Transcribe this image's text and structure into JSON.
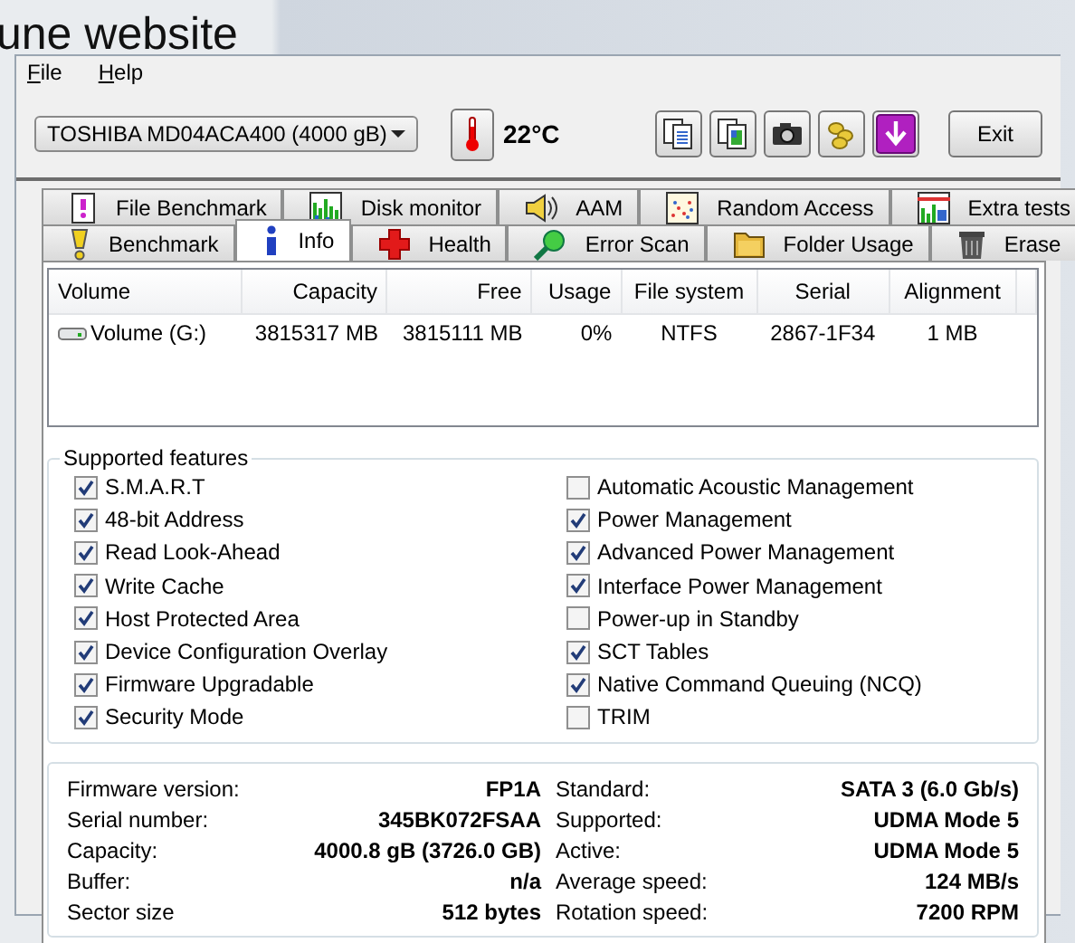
{
  "background": {
    "title": "une website"
  },
  "menu": [
    {
      "label": "File"
    },
    {
      "label": "Help"
    }
  ],
  "toolbar": {
    "drive": "TOSHIBA MD04ACA400 (4000 gB)",
    "temperature": "22°C",
    "buttons": [
      {
        "kind": "copy"
      },
      {
        "kind": "copy_color"
      },
      {
        "kind": "camera"
      },
      {
        "kind": "coins"
      },
      {
        "kind": "download"
      }
    ],
    "exit": "Exit"
  },
  "tabs": [
    [
      {
        "label": "File Benchmark",
        "kind": "page",
        "selected": false
      },
      {
        "label": "Disk monitor",
        "kind": "bars",
        "selected": false
      },
      {
        "label": "AAM",
        "kind": "speaker",
        "selected": false
      },
      {
        "label": "Random Access",
        "kind": "scatter",
        "selected": false
      },
      {
        "label": "Extra tests",
        "kind": "chart",
        "selected": false
      }
    ],
    [
      {
        "label": "Benchmark",
        "kind": "exclaim",
        "selected": false
      },
      {
        "label": "Info",
        "kind": "info",
        "selected": true
      },
      {
        "label": "Health",
        "kind": "cross",
        "selected": false
      },
      {
        "label": "Error Scan",
        "kind": "magnifier",
        "selected": false
      },
      {
        "label": "Folder Usage",
        "kind": "folder",
        "selected": false
      },
      {
        "label": "Erase",
        "kind": "trash",
        "selected": false
      }
    ]
  ],
  "volumes": {
    "columns": [
      "Volume",
      "Capacity",
      "Free",
      "Usage",
      "File system",
      "Serial",
      "Alignment"
    ],
    "rows": [
      [
        "Volume (G:)",
        "3815317 MB",
        "3815111 MB",
        "0%",
        "NTFS",
        "2867-1F34",
        "1 MB"
      ]
    ]
  },
  "features": {
    "title": "Supported features",
    "left": [
      {
        "label": "S.M.A.R.T",
        "checked": true
      },
      {
        "label": "48-bit Address",
        "checked": true
      },
      {
        "label": "Read Look-Ahead",
        "checked": true
      },
      {
        "label": "Write Cache",
        "checked": true
      },
      {
        "label": "Host Protected Area",
        "checked": true
      },
      {
        "label": "Device Configuration Overlay",
        "checked": true
      },
      {
        "label": "Firmware Upgradable",
        "checked": true
      },
      {
        "label": "Security Mode",
        "checked": true
      }
    ],
    "right": [
      {
        "label": "Automatic Acoustic Management",
        "checked": false
      },
      {
        "label": "Power Management",
        "checked": true
      },
      {
        "label": "Advanced Power Management",
        "checked": true
      },
      {
        "label": "Interface Power Management",
        "checked": true
      },
      {
        "label": "Power-up in Standby",
        "checked": false
      },
      {
        "label": "SCT Tables",
        "checked": true
      },
      {
        "label": "Native Command Queuing (NCQ)",
        "checked": true
      },
      {
        "label": "TRIM",
        "checked": false
      }
    ]
  },
  "info": {
    "left": [
      {
        "label": "Firmware version:",
        "value": "FP1A"
      },
      {
        "label": "Serial number:",
        "value": "345BK072FSAA"
      },
      {
        "label": "Capacity:",
        "value": "4000.8 gB (3726.0 GB)"
      },
      {
        "label": "Buffer:",
        "value": "n/a"
      },
      {
        "label": "Sector size",
        "value": "512 bytes"
      }
    ],
    "right": [
      {
        "label": "Standard:",
        "value": "SATA 3 (6.0 Gb/s)"
      },
      {
        "label": "Supported:",
        "value": "UDMA Mode 5"
      },
      {
        "label": "Active:",
        "value": "UDMA Mode 5"
      },
      {
        "label": "Average speed:",
        "value": "124 MB/s"
      },
      {
        "label": "Rotation speed:",
        "value": "7200 RPM"
      }
    ]
  }
}
